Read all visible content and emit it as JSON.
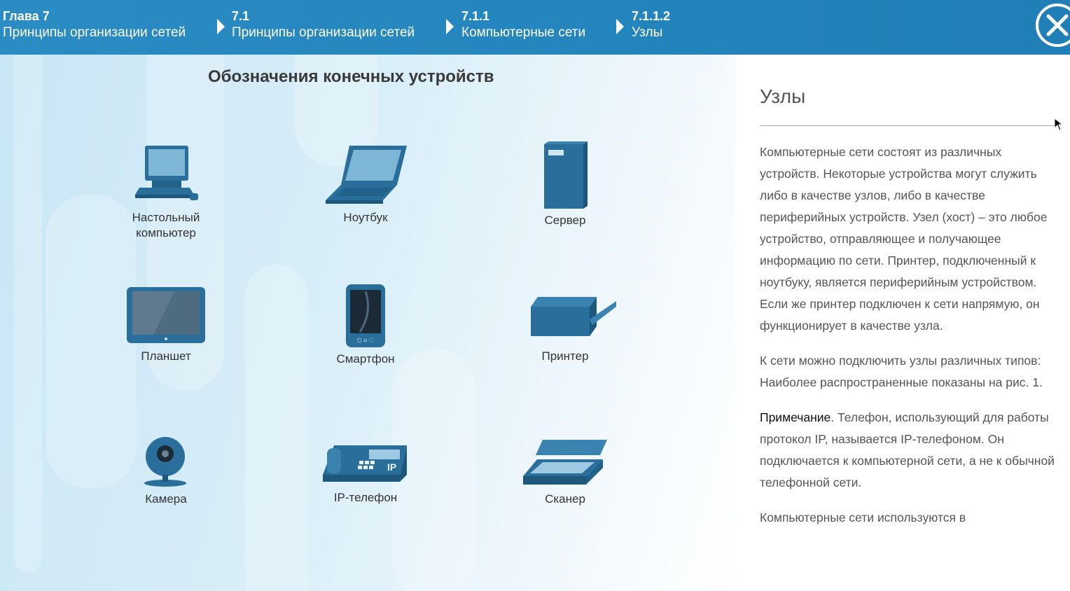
{
  "breadcrumbs": [
    {
      "num": "Глава 7",
      "title": "Принципы организации сетей"
    },
    {
      "num": "7.1",
      "title": "Принципы организации сетей"
    },
    {
      "num": "7.1.1",
      "title": "Компьютерные сети"
    },
    {
      "num": "7.1.1.2",
      "title": "Узлы"
    }
  ],
  "colors": {
    "header": "#2486bd",
    "accent": "#2a90d0",
    "device": "#2a6f9c"
  },
  "figure": {
    "title": "Обозначения конечных устройств",
    "devices": [
      {
        "label1": "Настольный",
        "label2": "компьютер",
        "icon": "desktop-icon"
      },
      {
        "label1": "Ноутбук",
        "label2": "",
        "icon": "laptop-icon"
      },
      {
        "label1": "Сервер",
        "label2": "",
        "icon": "server-icon"
      },
      {
        "label1": "Планшет",
        "label2": "",
        "icon": "tablet-icon"
      },
      {
        "label1": "Смартфон",
        "label2": "",
        "icon": "smartphone-icon"
      },
      {
        "label1": "Принтер",
        "label2": "",
        "icon": "printer-icon"
      },
      {
        "label1": "Камера",
        "label2": "",
        "icon": "camera-icon"
      },
      {
        "label1": "IP-телефон",
        "label2": "",
        "icon": "ip-phone-icon",
        "ip_text": "IP"
      },
      {
        "label1": "Сканер",
        "label2": "",
        "icon": "scanner-icon"
      }
    ]
  },
  "panel": {
    "heading": "Узлы",
    "p1": "Компьютерные сети состоят из различных устройств. Некоторые устройства могут служить либо в качестве узлов, либо в качестве периферийных устройств. Узел (хост) – это любое устройство, отправляющее и получающее информацию по сети. Принтер, подключенный к ноутбуку, является периферийным устройством. Если же принтер подключен к сети напрямую, он функционирует в качестве узла.",
    "p2": "К сети можно подключить узлы различных типов: Наиболее распространенные показаны на рис. 1.",
    "p3_label": "Примечание",
    "p3_text": ". Телефон, использующий для работы протокол IP, называется IP-телефоном. Он подключается к компьютерной сети, а не к обычной телефонной сети.",
    "p4": "Компьютерные сети используются в"
  }
}
